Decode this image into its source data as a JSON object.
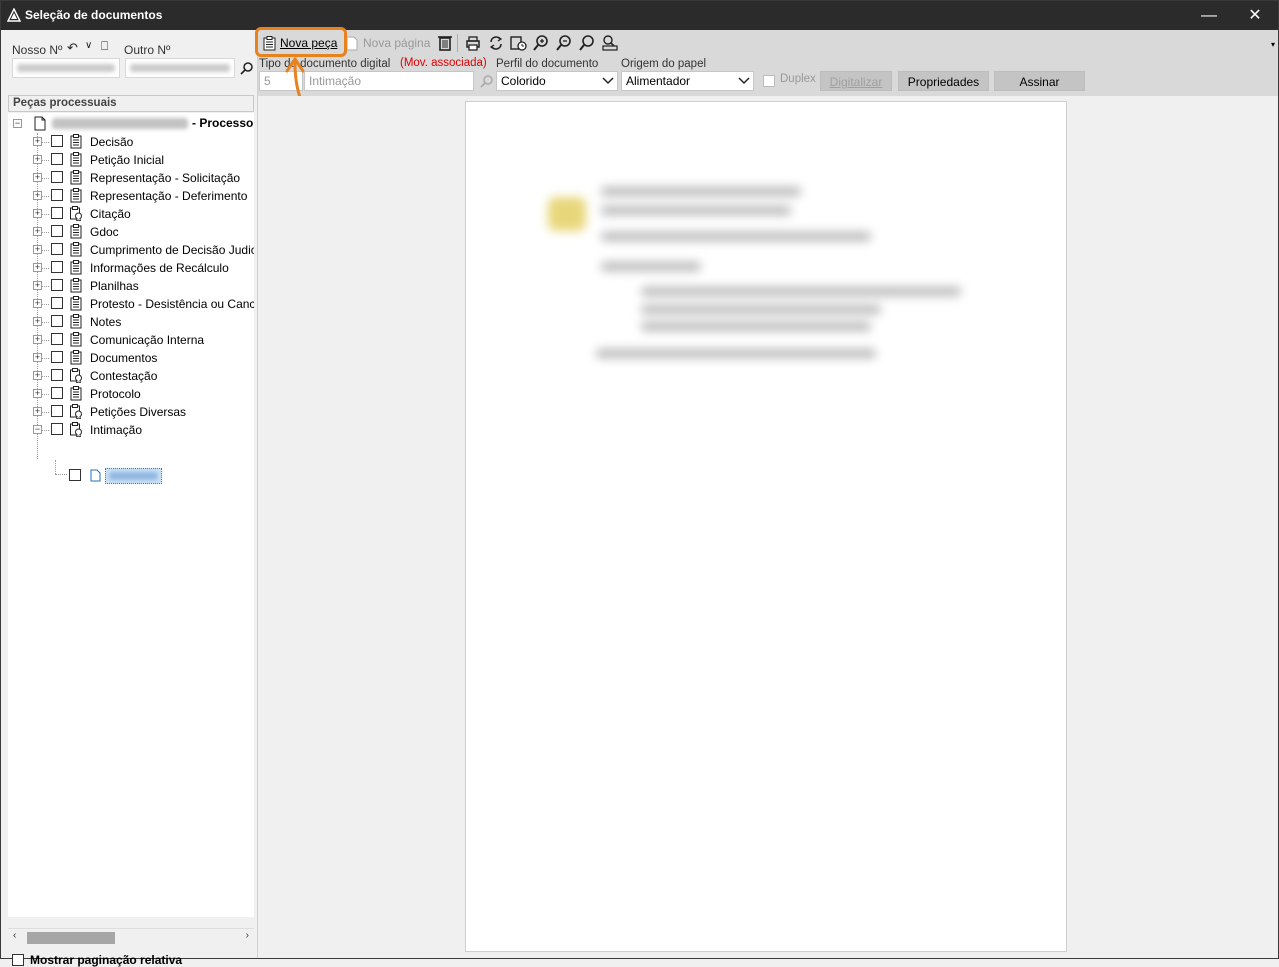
{
  "window": {
    "title": "Seleção de documentos",
    "min_glyph": "—",
    "close_glyph": "✕"
  },
  "left": {
    "nosso_label": "Nosso Nº",
    "outro_label": "Outro Nº",
    "tree_header": "Peças processuais",
    "root_label": "- Processo C",
    "items": [
      {
        "label": "Decisão",
        "icon": "clipboard-icon"
      },
      {
        "label": "Petição Inicial",
        "icon": "clipboard-icon"
      },
      {
        "label": "Representação - Solicitação",
        "icon": "clipboard-icon"
      },
      {
        "label": "Representação - Deferimento",
        "icon": "clipboard-icon"
      },
      {
        "label": "Citação",
        "icon": "signed-document-icon"
      },
      {
        "label": "Gdoc",
        "icon": "clipboard-icon"
      },
      {
        "label": "Cumprimento de Decisão Judicial",
        "icon": "clipboard-icon"
      },
      {
        "label": "Informações de Recálculo",
        "icon": "clipboard-icon"
      },
      {
        "label": "Planilhas",
        "icon": "clipboard-icon"
      },
      {
        "label": "Protesto - Desistência ou Cancelamento",
        "icon": "clipboard-icon"
      },
      {
        "label": "Notes",
        "icon": "clipboard-icon"
      },
      {
        "label": "Comunicação Interna",
        "icon": "clipboard-icon"
      },
      {
        "label": "Documentos",
        "icon": "clipboard-icon"
      },
      {
        "label": "Contestação",
        "icon": "signed-document-icon"
      },
      {
        "label": "Protocolo",
        "icon": "clipboard-icon"
      },
      {
        "label": "Petições Diversas",
        "icon": "signed-document-icon"
      },
      {
        "label": "Intimação",
        "icon": "signed-document-icon"
      }
    ],
    "bottom_checkbox": "Mostrar paginação relativa"
  },
  "toolbar": {
    "nova_peca": "Nova peça",
    "nova_pagina": "Nova página",
    "tipo_label": "Tipo de documento digital",
    "mov_associada": "(Mov. associada)",
    "tipo_code": "5",
    "tipo_value": "Intimação",
    "perfil_label": "Perfil do documento",
    "perfil_value": "Colorido",
    "origem_label": "Origem do papel",
    "origem_value": "Alimentador",
    "duplex": "Duplex",
    "digitalizar": "Digitalizar",
    "propriedades": "Propriedades",
    "assinar": "Assinar",
    "accent_color": "#e8821e",
    "mov_color": "#e00000"
  }
}
